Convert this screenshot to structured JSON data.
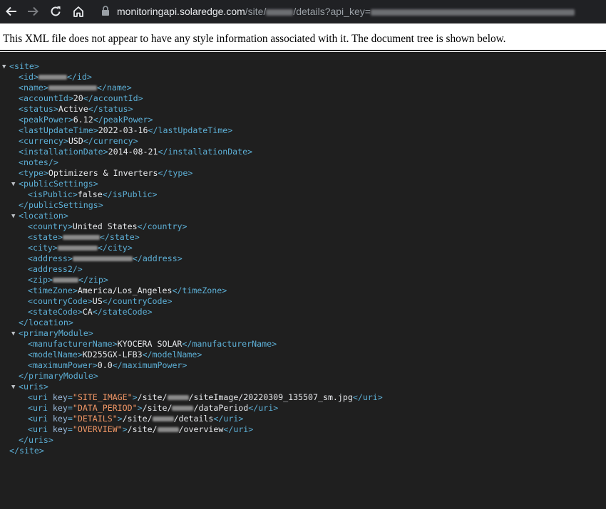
{
  "browser": {
    "url_domain": "monitoringapi.solaredge.com",
    "url_path_1": "/site/",
    "url_path_2": "/details?api_key="
  },
  "banner_text": "This XML file does not appear to have any style information associated with it. The document tree is shown below.",
  "xml": {
    "site_tag": "site",
    "id_tag": "id",
    "name_tag": "name",
    "accountId_tag": "accountId",
    "accountId": "20",
    "status_tag": "status",
    "status": "Active",
    "peakPower_tag": "peakPower",
    "peakPower": "6.12",
    "lastUpdateTime_tag": "lastUpdateTime",
    "lastUpdateTime": "2022-03-16",
    "currency_tag": "currency",
    "currency": "USD",
    "installationDate_tag": "installationDate",
    "installationDate": "2014-08-21",
    "notes_tag": "notes",
    "type_tag": "type",
    "type": "Optimizers & Inverters",
    "publicSettings_tag": "publicSettings",
    "isPublic_tag": "isPublic",
    "isPublic": "false",
    "location_tag": "location",
    "country_tag": "country",
    "country": "United States",
    "state_tag": "state",
    "city_tag": "city",
    "address_tag": "address",
    "address2_tag": "address2",
    "zip_tag": "zip",
    "timeZone_tag": "timeZone",
    "timeZone": "America/Los_Angeles",
    "countryCode_tag": "countryCode",
    "countryCode": "US",
    "stateCode_tag": "stateCode",
    "stateCode": "CA",
    "primaryModule_tag": "primaryModule",
    "manufacturerName_tag": "manufacturerName",
    "manufacturerName": "KYOCERA SOLAR",
    "modelName_tag": "modelName",
    "modelName": "KD255GX-LFB3",
    "maximumPower_tag": "maximumPower",
    "maximumPower": "0.0",
    "uris_tag": "uris",
    "uri_tag": "uri",
    "key_attr": "key",
    "uri1_key": "\"SITE_IMAGE\"",
    "uri1_pre": "/site/",
    "uri1_post": "/siteImage/20220309_135507_sm.jpg",
    "uri2_key": "\"DATA_PERIOD\"",
    "uri2_pre": "/site/",
    "uri2_post": "/dataPeriod",
    "uri3_key": "\"DETAILS\"",
    "uri3_pre": "/site/",
    "uri3_post": "/details",
    "uri4_key": "\"OVERVIEW\"",
    "uri4_pre": "/site/",
    "uri4_post": "/overview"
  }
}
